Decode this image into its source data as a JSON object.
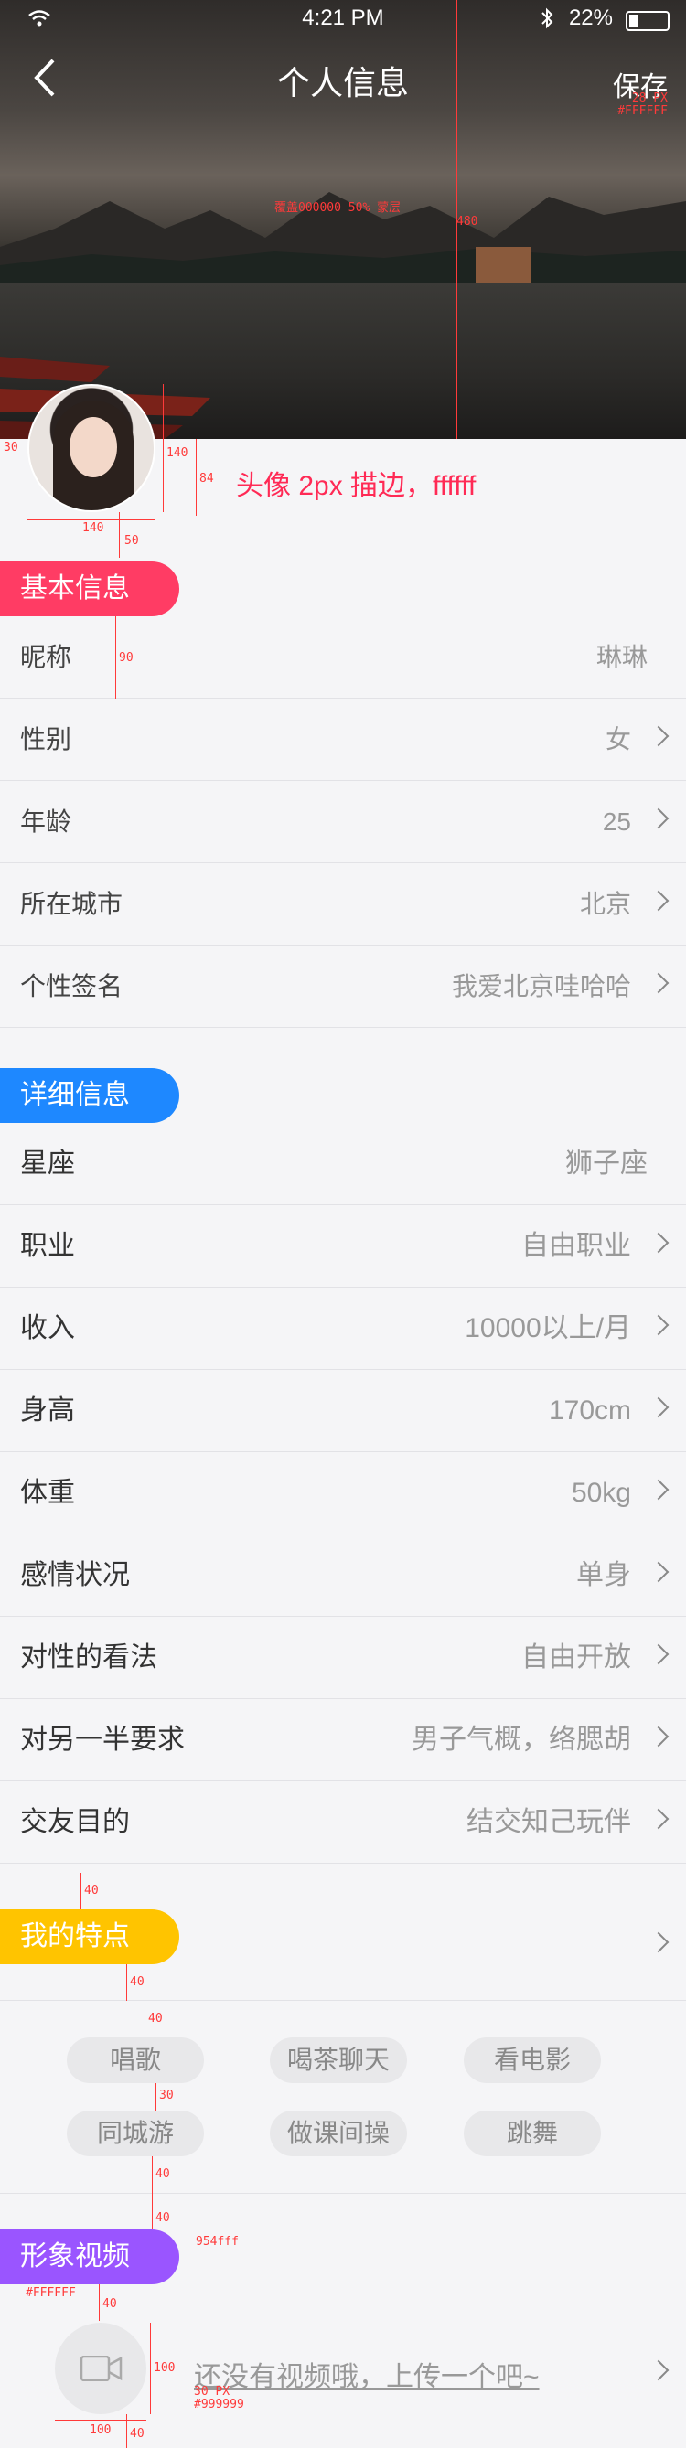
{
  "status": {
    "time": "4:21 PM",
    "battery": "22%"
  },
  "header": {
    "title": "个人信息",
    "save": "保存",
    "save_note_size": "28 PX",
    "save_note_color": "#FFFFFF",
    "hero_caption": "覆盖000000  50%  蒙层",
    "hero_height": "480"
  },
  "avatar": {
    "note": "头像 2px 描边，ffffff",
    "dim_w": "140",
    "dim_h": "140",
    "dim_84": "84",
    "dim_30": "30",
    "dim_50": "50"
  },
  "basic": {
    "tag": "基本信息",
    "dim_90": "90",
    "rows": [
      {
        "label": "昵称",
        "value": "琳琳"
      },
      {
        "label": "性别",
        "value": "女"
      },
      {
        "label": "年龄",
        "value": "25"
      },
      {
        "label": "所在城市",
        "value": "北京"
      },
      {
        "label": "个性签名",
        "value": "我爱北京哇哈哈"
      }
    ]
  },
  "detail": {
    "tag": "详细信息",
    "rows": [
      {
        "label": "星座",
        "value": "狮子座"
      },
      {
        "label": "职业",
        "value": "自由职业"
      },
      {
        "label": "收入",
        "value": "10000以上/月"
      },
      {
        "label": "身高",
        "value": "170cm"
      },
      {
        "label": "体重",
        "value": "50kg"
      },
      {
        "label": "感情状况",
        "value": "单身"
      },
      {
        "label": "对性的看法",
        "value": "自由开放"
      },
      {
        "label": "对另一半要求",
        "value": "男子气概，络腮胡"
      },
      {
        "label": "交友目的",
        "value": "结交知己玩伴"
      }
    ]
  },
  "traits": {
    "tag": "我的特点",
    "chips": [
      "唱歌",
      "喝茶聊天",
      "看电影",
      "同城游",
      "做课间操",
      "跳舞"
    ],
    "dim_40a": "40",
    "dim_40b": "40",
    "dim_40c": "40",
    "dim_30": "30",
    "dim_40d": "40",
    "dim_40e": "40"
  },
  "video": {
    "tag": "形象视频",
    "tag_color_note": "954fff",
    "tag_text_note": "#FFFFFF",
    "placeholder": "还没有视频哦，上传一个吧~",
    "placeholder_size": "30 PX",
    "placeholder_color": "#999999",
    "dim_40": "40",
    "dim_100": "100",
    "dim_100b": "100",
    "dim_40b": "40"
  },
  "colors": {
    "basic_tag": "#ff3c64",
    "detail_tag": "#1e88ff",
    "traits_tag": "#ffc400",
    "video_tag": "#9a55ff"
  }
}
